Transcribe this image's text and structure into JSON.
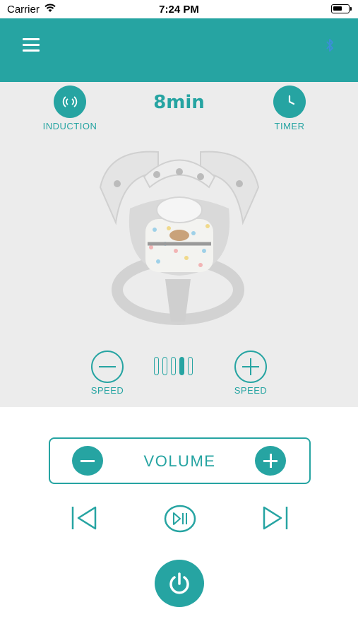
{
  "status_bar": {
    "carrier": "Carrier",
    "time": "7:24 PM",
    "icons": [
      "wifi-icon",
      "battery-icon"
    ]
  },
  "header": {
    "menu_icon": "hamburger-menu-icon",
    "bluetooth_icon": "bluetooth-icon",
    "background_color": "#26a4a2"
  },
  "controls": {
    "induction_label": "INDUCTION",
    "timer_label": "TIMER",
    "timer_value": "8min"
  },
  "product": {
    "image_subject": "baby swing bouncer"
  },
  "speed": {
    "decrease_label": "SPEED",
    "increase_label": "SPEED",
    "level": 4,
    "levels": 5
  },
  "volume": {
    "label": "VOLUME"
  },
  "media": {
    "icons": [
      "previous-track-icon",
      "play-pause-icon",
      "next-track-icon"
    ]
  },
  "power": {
    "icon": "power-icon"
  },
  "colors": {
    "accent": "#26a4a2",
    "panel": "#ececec"
  }
}
